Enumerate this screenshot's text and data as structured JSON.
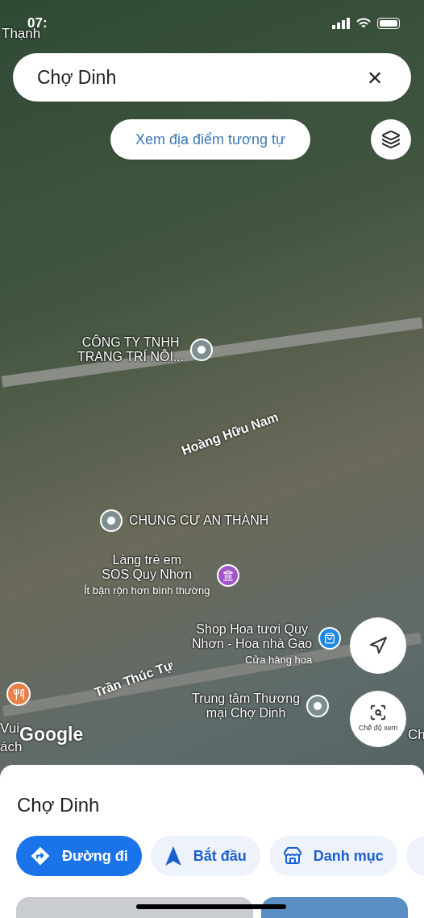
{
  "status_bar": {
    "time": "07:"
  },
  "search": {
    "value": "Chợ Dinh",
    "clear": "×"
  },
  "similar_button": "Xem địa điểm tương tự",
  "map": {
    "places": [
      {
        "label": "Thạnh",
        "kind": "edge"
      },
      {
        "label": "CÔNG TY TNHH\nTRANG TRÍ NỘI...",
        "kind": "pin"
      },
      {
        "label": "Hoàng Hữu Nam",
        "kind": "street"
      },
      {
        "label": "CHUNG CƯ AN THÀNH",
        "kind": "pin"
      },
      {
        "label": "Làng trẻ em\nSOS Quy Nhơn",
        "sublabel": "Ít bận rộn hơn bình thường",
        "kind": "school"
      },
      {
        "label": "Shop Hoa tươi Quy\nNhơn - Hoa nhà Gạo",
        "sublabel": "Cửa hàng hoa",
        "kind": "shop"
      },
      {
        "label": "Trần Thúc Tự",
        "kind": "street"
      },
      {
        "label": "Trung tâm Thương\nmại Chợ Dinh",
        "kind": "pin"
      },
      {
        "label": "Vui",
        "kind": "edge"
      },
      {
        "label": "ách",
        "kind": "edge"
      },
      {
        "label": "Ch",
        "kind": "edge"
      },
      {
        "kind": "food"
      }
    ],
    "logo": "Google",
    "view_mode_button": "Chế độ xem"
  },
  "sheet": {
    "title": "Chợ Dinh",
    "actions": [
      {
        "label": "Đường đi",
        "kind": "directions",
        "selected": true
      },
      {
        "label": "Bắt đầu",
        "kind": "start",
        "selected": false
      },
      {
        "label": "Danh mục",
        "kind": "list",
        "selected": false
      }
    ]
  }
}
